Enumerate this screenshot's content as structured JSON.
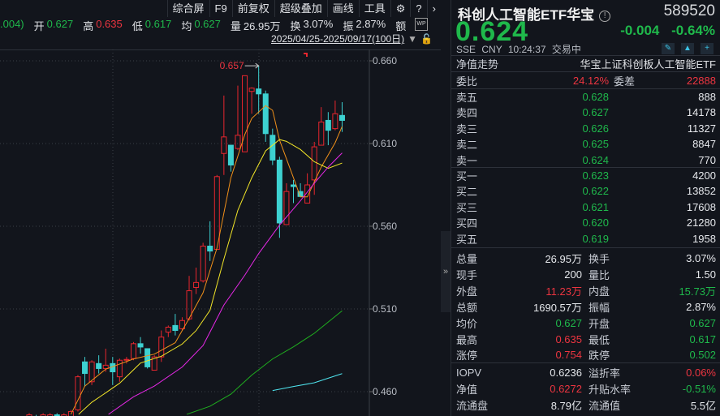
{
  "toolbar": {
    "items": [
      "综合屏",
      "F9",
      "前复权",
      "超级叠加",
      "画线",
      "工具"
    ],
    "gear": "⚙",
    "help": "?",
    "next": "›"
  },
  "info": {
    "prev_tail": ".004)",
    "open_label": "开",
    "open": "0.627",
    "high_label": "高",
    "high": "0.635",
    "low_label": "低",
    "low": "0.617",
    "avg_label": "均",
    "avg": "0.627",
    "vol_label": "量",
    "vol": "26.95万",
    "turn_label": "换",
    "turn": "3.07%",
    "amp_label": "振",
    "amp": "2.87%",
    "amt_label": "额",
    "wp": "WP"
  },
  "date_range": "2025/04/25-2025/09/17(100日)",
  "colors": {
    "up": "#e8262e",
    "down": "#3dd1d1",
    "ma5": "#f0901a",
    "ma10": "#f2e528",
    "ma20": "#e628e6",
    "ma60": "#1fae1f",
    "ma120": "#4fe6f0"
  },
  "chart_data": {
    "type": "candlestick",
    "ylim": [
      0.4453,
      0.6667
    ],
    "yticks": [
      "0.660",
      "0.610",
      "0.560",
      "0.510",
      "0.460"
    ],
    "ytick_values": [
      0.66,
      0.61,
      0.56,
      0.51,
      0.46
    ],
    "max_label": "0.657",
    "max_index": 33,
    "candles": [
      [
        0,
        0.444,
        0.447,
        0.44,
        0.446
      ],
      [
        1,
        0.445,
        0.446,
        0.441,
        0.444
      ],
      [
        2,
        0.444,
        0.447,
        0.44,
        0.446
      ],
      [
        3,
        0.444,
        0.447,
        0.442,
        0.446
      ],
      [
        4,
        0.446,
        0.447,
        0.443,
        0.444
      ],
      [
        5,
        0.443,
        0.447,
        0.441,
        0.446
      ],
      [
        6,
        0.441,
        0.449,
        0.44,
        0.448
      ],
      [
        7,
        0.449,
        0.47,
        0.448,
        0.469
      ],
      [
        8,
        0.478,
        0.481,
        0.463,
        0.471
      ],
      [
        9,
        0.466,
        0.479,
        0.464,
        0.478
      ],
      [
        10,
        0.477,
        0.482,
        0.471,
        0.474
      ],
      [
        11,
        0.474,
        0.486,
        0.472,
        0.476
      ],
      [
        12,
        0.477,
        0.481,
        0.464,
        0.472
      ],
      [
        13,
        0.469,
        0.48,
        0.466,
        0.479
      ],
      [
        14,
        0.479,
        0.481,
        0.477,
        0.4795
      ],
      [
        15,
        0.48,
        0.49,
        0.479,
        0.489
      ],
      [
        16,
        0.489,
        0.493,
        0.483,
        0.487
      ],
      [
        17,
        0.486,
        0.486,
        0.474,
        0.475
      ],
      [
        18,
        0.473,
        0.482,
        0.473,
        0.481
      ],
      [
        19,
        0.481,
        0.497,
        0.478,
        0.493
      ],
      [
        20,
        0.496,
        0.5,
        0.493,
        0.499
      ],
      [
        21,
        0.5,
        0.507,
        0.494,
        0.497
      ],
      [
        22,
        0.498,
        0.505,
        0.497,
        0.503
      ],
      [
        23,
        0.504,
        0.53,
        0.503,
        0.521
      ],
      [
        24,
        0.523,
        0.535,
        0.519,
        0.526
      ],
      [
        25,
        0.527,
        0.55,
        0.526,
        0.548
      ],
      [
        26,
        0.548,
        0.563,
        0.539,
        0.545
      ],
      [
        27,
        0.546,
        0.591,
        0.546,
        0.59
      ],
      [
        28,
        0.604,
        0.639,
        0.591,
        0.614
      ],
      [
        29,
        0.609,
        0.609,
        0.593,
        0.597
      ],
      [
        30,
        0.607,
        0.645,
        0.606,
        0.615
      ],
      [
        31,
        0.605,
        0.651,
        0.605,
        0.651
      ],
      [
        32,
        0.6415,
        0.644,
        0.628,
        0.6435
      ],
      [
        33,
        0.643,
        0.657,
        0.628,
        0.64
      ],
      [
        34,
        0.64,
        0.642,
        0.611,
        0.616
      ],
      [
        35,
        0.615,
        0.619,
        0.597,
        0.6
      ],
      [
        36,
        0.6,
        0.602,
        0.553,
        0.562
      ],
      [
        37,
        0.561,
        0.586,
        0.561,
        0.581
      ],
      [
        38,
        0.585,
        0.588,
        0.574,
        0.584
      ],
      [
        39,
        0.581,
        0.586,
        0.578,
        0.578
      ],
      [
        40,
        0.574,
        0.592,
        0.574,
        0.585
      ],
      [
        41,
        0.588,
        0.611,
        0.579,
        0.608
      ],
      [
        42,
        0.609,
        0.632,
        0.609,
        0.623
      ],
      [
        43,
        0.624,
        0.629,
        0.609,
        0.618
      ],
      [
        44,
        0.619,
        0.636,
        0.618,
        0.628
      ],
      [
        45,
        0.627,
        0.635,
        0.617,
        0.624
      ]
    ],
    "ma": [
      {
        "name": "MA5",
        "color_key": "ma5",
        "points": [
          [
            6,
            0.4463
          ],
          [
            8,
            0.4634
          ],
          [
            11,
            0.4736
          ],
          [
            15,
            0.4798
          ],
          [
            18,
            0.4827
          ],
          [
            21,
            0.4896
          ],
          [
            23,
            0.5043
          ],
          [
            25,
            0.5198
          ],
          [
            27,
            0.5468
          ],
          [
            29,
            0.5893
          ],
          [
            31,
            0.6154
          ],
          [
            32,
            0.6252
          ],
          [
            34,
            0.6329
          ],
          [
            35,
            0.6301
          ],
          [
            36,
            0.6121
          ],
          [
            38,
            0.5893
          ],
          [
            39,
            0.5778
          ],
          [
            40,
            0.5778
          ],
          [
            42,
            0.5958
          ],
          [
            44,
            0.6105
          ],
          [
            45,
            0.6203
          ]
        ]
      },
      {
        "name": "MA10",
        "color_key": "ma10",
        "points": [
          [
            7.1,
            0.4463
          ],
          [
            9,
            0.4536
          ],
          [
            11,
            0.4593
          ],
          [
            13,
            0.4651
          ],
          [
            16,
            0.4773
          ],
          [
            19,
            0.4814
          ],
          [
            22,
            0.4888
          ],
          [
            24,
            0.4969
          ],
          [
            26,
            0.5092
          ],
          [
            28,
            0.5402
          ],
          [
            30,
            0.5696
          ],
          [
            32,
            0.5893
          ],
          [
            34,
            0.6056
          ],
          [
            36,
            0.6124
          ],
          [
            37,
            0.6113
          ],
          [
            39,
            0.6064
          ],
          [
            41,
            0.599
          ],
          [
            43,
            0.595
          ],
          [
            45,
            0.5982
          ]
        ]
      },
      {
        "name": "MA20",
        "color_key": "ma20",
        "points": [
          [
            11.4,
            0.4463
          ],
          [
            15,
            0.4569
          ],
          [
            18,
            0.4634
          ],
          [
            22,
            0.4749
          ],
          [
            25,
            0.4879
          ],
          [
            28,
            0.5124
          ],
          [
            31,
            0.5304
          ],
          [
            33,
            0.5435
          ],
          [
            36,
            0.5607
          ],
          [
            39,
            0.5754
          ],
          [
            41,
            0.586
          ],
          [
            43,
            0.5958
          ],
          [
            45,
            0.6043
          ]
        ]
      },
      {
        "name": "MA60",
        "color_key": "ma60",
        "points": [
          [
            22.65,
            0.4463
          ],
          [
            26,
            0.4512
          ],
          [
            29,
            0.4585
          ],
          [
            32,
            0.47
          ],
          [
            35,
            0.4798
          ],
          [
            38,
            0.4871
          ],
          [
            41,
            0.4953
          ],
          [
            45,
            0.5089
          ]
        ]
      },
      {
        "name": "MA120",
        "color_key": "ma120",
        "points": [
          [
            35,
            0.4607
          ],
          [
            38,
            0.4631
          ],
          [
            41,
            0.4654
          ],
          [
            45,
            0.4709
          ]
        ]
      }
    ]
  },
  "quote": {
    "name": "科创人工智能ETF华宝",
    "code": "589520",
    "price": "0.624",
    "change": "-0.004",
    "change_pct": "-0.64%",
    "exchange": "SSE",
    "currency": "CNY",
    "time": "10:24:37",
    "status": "交易中"
  },
  "nav_row": {
    "label": "净值走势",
    "fund_name": "华宝上证科创板人工智能ETF"
  },
  "weibi": {
    "label": "委比",
    "value": "24.12%",
    "diff_label": "委差",
    "diff": "22888"
  },
  "asks": [
    {
      "label": "卖五",
      "price": "0.628",
      "vol": "888"
    },
    {
      "label": "卖四",
      "price": "0.627",
      "vol": "14178"
    },
    {
      "label": "卖三",
      "price": "0.626",
      "vol": "11327"
    },
    {
      "label": "卖二",
      "price": "0.625",
      "vol": "8847"
    },
    {
      "label": "卖一",
      "price": "0.624",
      "vol": "770"
    }
  ],
  "bids": [
    {
      "label": "买一",
      "price": "0.623",
      "vol": "4200"
    },
    {
      "label": "买二",
      "price": "0.622",
      "vol": "13852"
    },
    {
      "label": "买三",
      "price": "0.621",
      "vol": "17608"
    },
    {
      "label": "买四",
      "price": "0.620",
      "vol": "21280"
    },
    {
      "label": "买五",
      "price": "0.619",
      "vol": "1958"
    }
  ],
  "stats": [
    {
      "l1": "总量",
      "v1": "26.95万",
      "c1": "white",
      "l2": "换手",
      "v2": "3.07%",
      "c2": "white"
    },
    {
      "l1": "现手",
      "v1": "200",
      "c1": "white",
      "l2": "量比",
      "v2": "1.50",
      "c2": "white"
    },
    {
      "l1": "外盘",
      "v1": "11.23万",
      "c1": "red",
      "l2": "内盘",
      "v2": "15.73万",
      "c2": "green"
    },
    {
      "l1": "总额",
      "v1": "1690.57万",
      "c1": "white",
      "l2": "振幅",
      "v2": "2.87%",
      "c2": "white"
    },
    {
      "l1": "均价",
      "v1": "0.627",
      "c1": "green",
      "l2": "开盘",
      "v2": "0.627",
      "c2": "green"
    },
    {
      "l1": "最高",
      "v1": "0.635",
      "c1": "red",
      "l2": "最低",
      "v2": "0.617",
      "c2": "green"
    },
    {
      "l1": "涨停",
      "v1": "0.754",
      "c1": "red",
      "l2": "跌停",
      "v2": "0.502",
      "c2": "green"
    }
  ],
  "etf": [
    {
      "l1": "IOPV",
      "v1": "0.6236",
      "c1": "white",
      "l2": "溢折率",
      "v2": "0.06%",
      "c2": "red"
    },
    {
      "l1": "净值",
      "v1": "0.6272",
      "c1": "red",
      "l2": "升贴水率",
      "v2": "-0.51%",
      "c2": "green"
    },
    {
      "l1": "流通盘",
      "v1": "8.79亿",
      "c1": "white",
      "l2": "流通值",
      "v2": "5.5亿",
      "c2": "white"
    }
  ],
  "collapse": "»"
}
